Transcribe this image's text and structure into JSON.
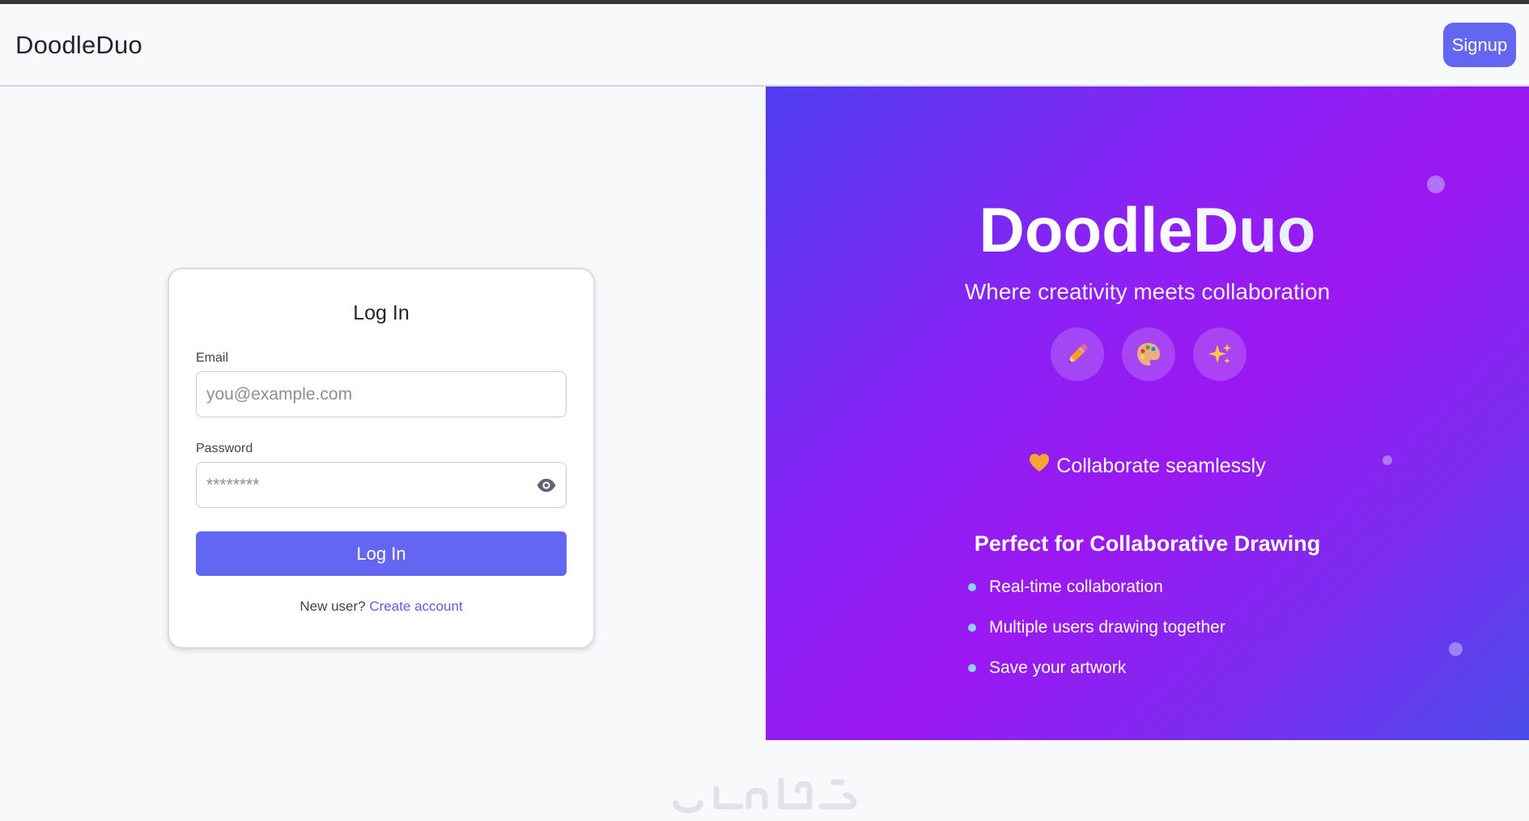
{
  "navbar": {
    "brand": "DoodleDuo",
    "signup_label": "Signup"
  },
  "login_card": {
    "title": "Log In",
    "email_label": "Email",
    "email_placeholder": "you@example.com",
    "email_value": "",
    "password_label": "Password",
    "password_placeholder": "********",
    "password_value": "",
    "password_toggle_icon": "eye-icon",
    "submit_label": "Log In",
    "new_user_text": "New user?",
    "create_account_link": "Create account"
  },
  "hero": {
    "title": "DoodleDuo",
    "subtitle": "Where creativity meets collaboration",
    "feature_icons": [
      "pencil-icon",
      "palette-icon",
      "sparkles-icon"
    ],
    "collab_icon": "heart-icon",
    "collab_text": "Collaborate seamlessly",
    "features_heading": "Perfect for Collaborative Drawing",
    "features": [
      "Real-time collaboration",
      "Multiple users drawing together",
      "Save your artwork"
    ]
  },
  "colors": {
    "accent": "#6366f1",
    "gradient_start": "#4f3df0",
    "gradient_mid": "#9b18f2",
    "gradient_end": "#4a4cea",
    "bullet": "#8fd0ff"
  }
}
